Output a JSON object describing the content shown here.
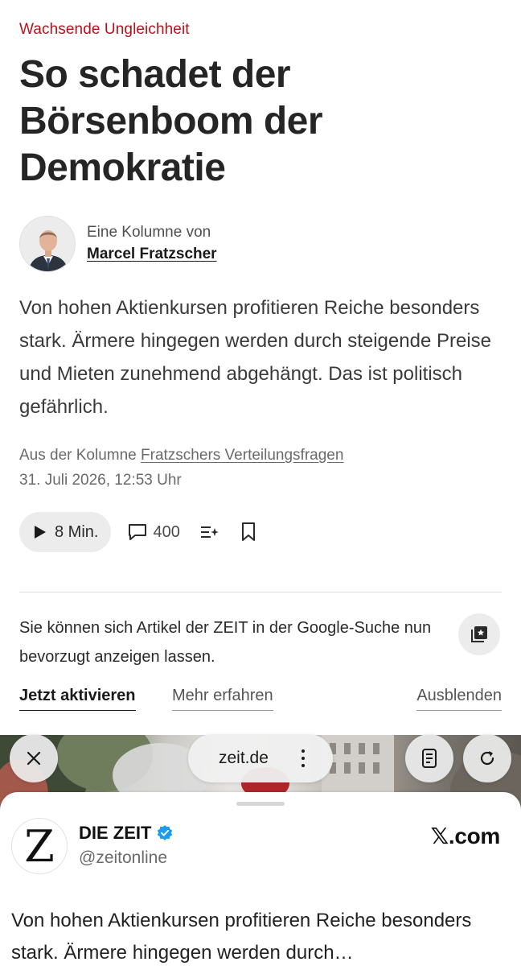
{
  "article": {
    "kicker": "Wachsende Ungleichheit",
    "headline": "So schadet der Börsenboom der Demokratie",
    "author_prefix": "Eine Kolumne von",
    "author_name": "Marcel Fratzscher",
    "teaser": "Von hohen Aktienkursen profitieren Reiche besonders stark. Ärmere hingegen werden durch steigende Preise und Mieten zunehmend abgehängt. Das ist politisch gefährlich.",
    "column_prefix": "Aus der Kolumne",
    "column_name": "Fratzschers Verteilungsfragen",
    "date": "31. Juli 2026, 12:53 Uhr"
  },
  "actions": {
    "listen_label": "8 Min.",
    "comments_count": "400",
    "icons": [
      "play-icon",
      "comment-icon",
      "summary-icon",
      "bookmark-icon"
    ]
  },
  "google_promo": {
    "text": "Sie können sich Artikel der ZEIT in der Google-Suche nun bevorzugt anzeigen lassen.",
    "activate_label": "Jetzt aktivieren",
    "learn_more_label": "Mehr erfahren",
    "dismiss_label": "Ausblenden",
    "icon": "preferred-source-icon"
  },
  "browser": {
    "url": "zeit.de",
    "icons": [
      "close-icon",
      "more-icon",
      "reader-icon",
      "reload-icon"
    ]
  },
  "embed": {
    "logo_letter": "Z",
    "account_name": "DIE ZEIT",
    "handle": "@zeitonline",
    "source": "𝕏.com",
    "text": "Von hohen Aktienkursen profitieren Reiche besonders stark. Ärmere hingegen werden durch…",
    "verified_color": "#1d9bf0"
  },
  "colors": {
    "kicker": "#b5121b",
    "text": "#1a1a1a",
    "muted": "#6a6a6a"
  }
}
